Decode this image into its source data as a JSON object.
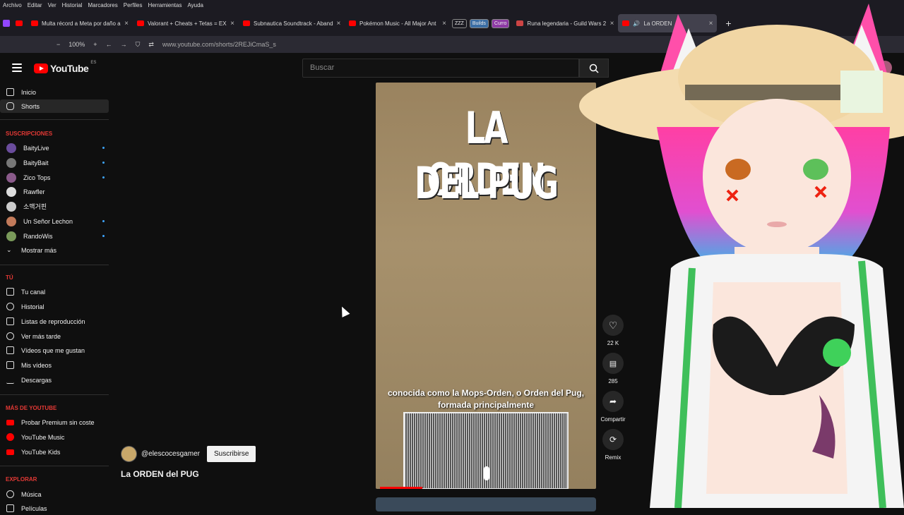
{
  "browser": {
    "menu": [
      "Archivo",
      "Editar",
      "Ver",
      "Historial",
      "Marcadores",
      "Perfiles",
      "Herramientas",
      "Ayuda"
    ],
    "tabs": [
      {
        "label": "Multa récord a Meta por daño a"
      },
      {
        "label": "Valorant + Cheats + Tetas = EX"
      },
      {
        "label": "Subnautica Soundtrack - Aband"
      },
      {
        "label": "Pokémon Music - All Major Ant"
      },
      {
        "label": "Runa legendaria - Guild Wars 2"
      },
      {
        "label": "La ORDEN"
      }
    ],
    "pills": [
      "ZZZ",
      "Builds",
      "Curro"
    ],
    "zoom": "100%",
    "url": "www.youtube.com/shorts/2REJiCmaS_s"
  },
  "youtube": {
    "logo_text": "YouTube",
    "region": "ES",
    "search_placeholder": "Buscar",
    "sidebar": {
      "main": [
        {
          "label": "Inicio"
        },
        {
          "label": "Shorts"
        }
      ],
      "subs_header": "SUSCRIPCIONES",
      "subs": [
        {
          "label": "BaityLive",
          "color": "#6a4c9c",
          "dot": true
        },
        {
          "label": "BaityBait",
          "color": "#777777",
          "dot": true
        },
        {
          "label": "Zico Tops",
          "color": "#8a5a8a",
          "dot": true
        },
        {
          "label": "Rawfler",
          "color": "#dddddd",
          "dot": false
        },
        {
          "label": "소맥거핀",
          "color": "#cccccc",
          "dot": false
        },
        {
          "label": "Un Señor Lechon",
          "color": "#c27a5a",
          "dot": true
        },
        {
          "label": "RandoWis",
          "color": "#7a9a5a",
          "dot": true
        }
      ],
      "show_more": "Mostrar más",
      "you_header": "TÚ",
      "you": [
        {
          "label": "Tu canal"
        },
        {
          "label": "Historial"
        },
        {
          "label": "Listas de reproducción"
        },
        {
          "label": "Ver más tarde"
        },
        {
          "label": "Vídeos que me gustan"
        },
        {
          "label": "Mis vídeos"
        },
        {
          "label": "Descargas"
        }
      ],
      "more_header": "MÁS DE YOUTUBE",
      "more": [
        {
          "label": "Probar Premium sin coste"
        },
        {
          "label": "YouTube Music"
        },
        {
          "label": "YouTube Kids"
        }
      ],
      "explore_header": "EXPLORAR",
      "explore": [
        {
          "label": "Música"
        },
        {
          "label": "Películas"
        }
      ]
    },
    "short": {
      "overlay_line1": "LA ORDEN",
      "overlay_line2": "DEL PUG",
      "caption": "conocida como la Mops-Orden, o Orden del Pug, formada principalmente",
      "likes": "22 K",
      "comments": "285",
      "share_label": "Compartir",
      "remix_label": "Remix",
      "channel": "@elescocesgamer",
      "subscribe_label": "Suscribirse",
      "title": "La ORDEN del PUG"
    }
  },
  "colors": {
    "accent": "#ff0000",
    "link": "#3ea6ff",
    "section": "#e53935"
  }
}
